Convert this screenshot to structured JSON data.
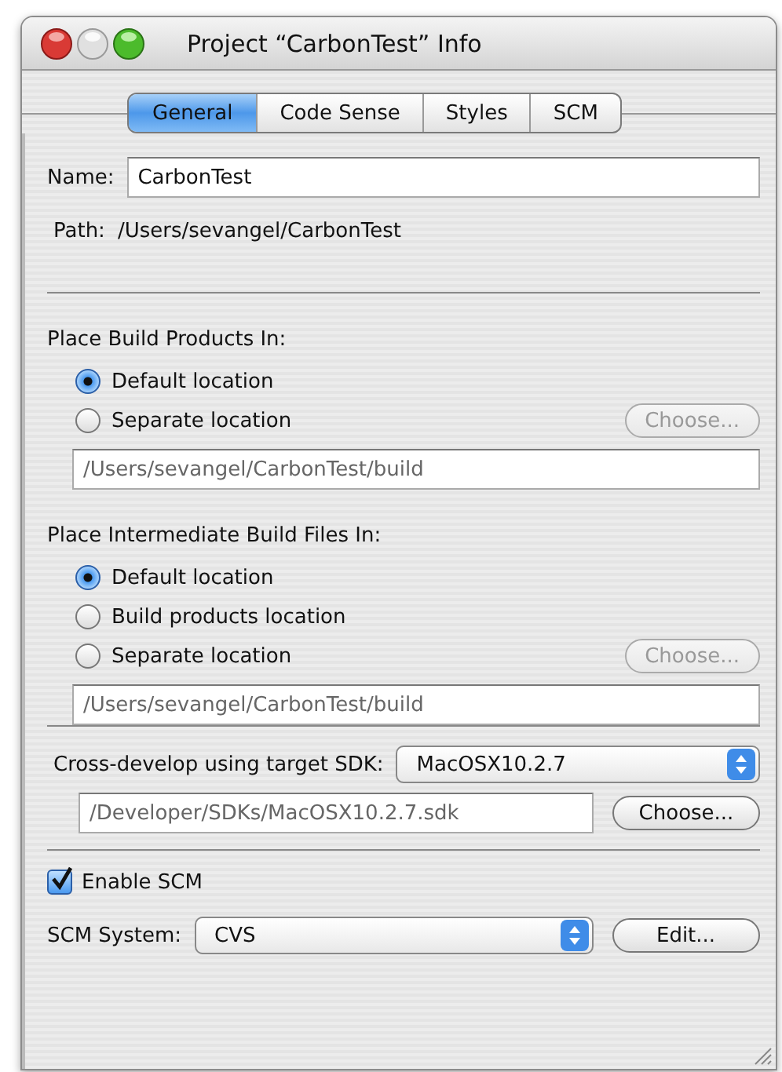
{
  "window": {
    "title": "Project “CarbonTest” Info"
  },
  "tabs": [
    {
      "label": "General",
      "selected": true
    },
    {
      "label": "Code Sense",
      "selected": false
    },
    {
      "label": "Styles",
      "selected": false
    },
    {
      "label": "SCM",
      "selected": false
    }
  ],
  "name_field": {
    "label": "Name:",
    "value": "CarbonTest"
  },
  "path": {
    "label": "Path:",
    "value": "/Users/sevangel/CarbonTest"
  },
  "sections": [
    {
      "heading": "Place Build Products In:",
      "options": [
        {
          "label": "Default location",
          "selected": true
        },
        {
          "label": "Separate location",
          "selected": false
        }
      ],
      "choose_button": {
        "label": "Choose...",
        "disabled": true
      },
      "path_field": {
        "value": "/Users/sevangel/CarbonTest/build"
      }
    },
    {
      "heading": "Place Intermediate Build Files In:",
      "options": [
        {
          "label": "Default location",
          "selected": true
        },
        {
          "label": "Build products location",
          "selected": false
        },
        {
          "label": "Separate location",
          "selected": false
        }
      ],
      "choose_button": {
        "label": "Choose...",
        "disabled": true
      },
      "path_field": {
        "value": "/Users/sevangel/CarbonTest/build"
      }
    }
  ],
  "sdk": {
    "label": "Cross-develop using target SDK:",
    "value": "MacOSX10.2.7",
    "path": "/Developer/SDKs/MacOSX10.2.7.sdk",
    "button": {
      "label": "Choose...",
      "disabled": false
    }
  },
  "enable_scm": {
    "label": "Enable SCM",
    "checked": true
  },
  "scm_system": {
    "label": "SCM System:",
    "value": "CVS",
    "button": {
      "label": "Edit...",
      "disabled": false
    }
  }
}
